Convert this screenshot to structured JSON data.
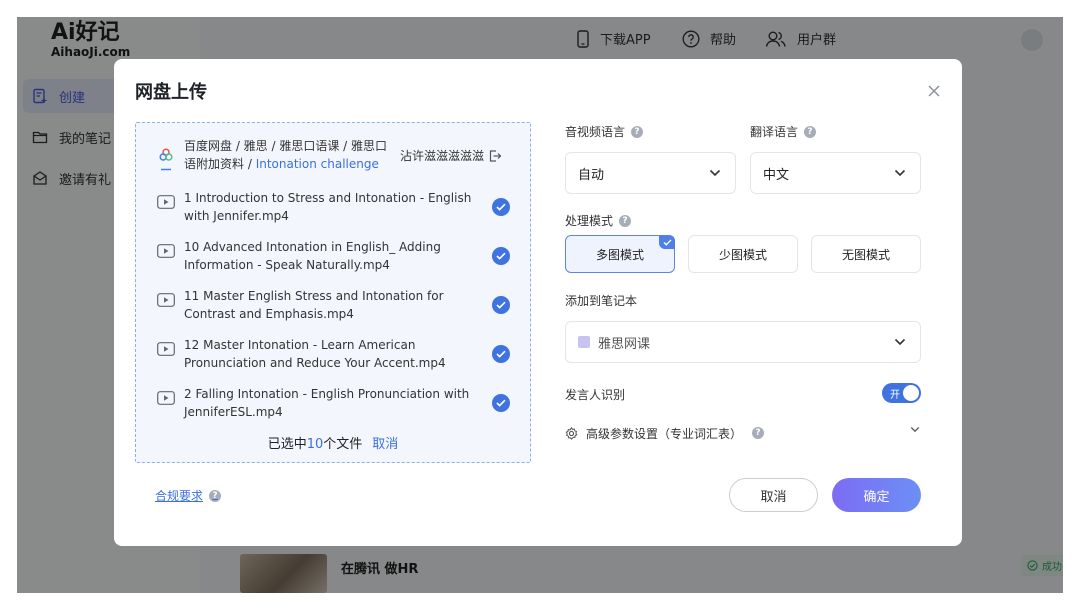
{
  "app": {
    "logo_main": "Ai好记",
    "logo_sub": "AihaoJi.com",
    "nav": [
      {
        "label": "创建",
        "icon": "create-note-icon"
      },
      {
        "label": "我的笔记",
        "icon": "folder-icon"
      },
      {
        "label": "邀请有礼",
        "icon": "gift-box-icon"
      }
    ],
    "header": {
      "download": "下载APP",
      "help": "帮助",
      "user_group": "用户群"
    },
    "bottom_title": "在腾讯 做HR",
    "status_badge": "成功"
  },
  "modal": {
    "title": "网盘上传",
    "path_prefix": "百度网盘 / 雅思 / 雅思口语课 / 雅思口语附加资料 / ",
    "path_current": "Intonation challenge",
    "account_name": "沾许滋滋滋滋滋",
    "files": [
      {
        "name": "1 Introduction to Stress and Intonation - English with Jennifer.mp4",
        "checked": true
      },
      {
        "name": "10 Advanced Intonation in English_ Adding Information - Speak Naturally.mp4",
        "checked": true
      },
      {
        "name": "11 Master English Stress and Intonation for Contrast and Emphasis.mp4",
        "checked": true
      },
      {
        "name": "12 Master Intonation - Learn American Pronunciation and Reduce Your Accent.mp4",
        "checked": true
      },
      {
        "name": "2 Falling Intonation - English Pronunciation with JenniferESL.mp4",
        "checked": true
      }
    ],
    "selected_prefix": "已选中",
    "selected_count": "10",
    "selected_suffix": "个文件",
    "selected_cancel": "取消",
    "compliance": "合规要求",
    "audio_lang_label": "音视频语言",
    "audio_lang_value": "自动",
    "translate_lang_label": "翻译语言",
    "translate_lang_value": "中文",
    "mode_label": "处理模式",
    "modes": [
      "多图模式",
      "少图模式",
      "无图模式"
    ],
    "active_mode": "多图模式",
    "notebook_label": "添加到笔记本",
    "notebook_value": "雅思网课",
    "speaker_label": "发言人识别",
    "speaker_toggle": "开",
    "advanced_label": "高级参数设置（专业词汇表）",
    "cancel_button": "取消",
    "confirm_button": "确定",
    "colors": {
      "accent": "#3e73e0",
      "confirm_start": "#7d6cf3",
      "confirm_end": "#6c8ff5"
    }
  }
}
